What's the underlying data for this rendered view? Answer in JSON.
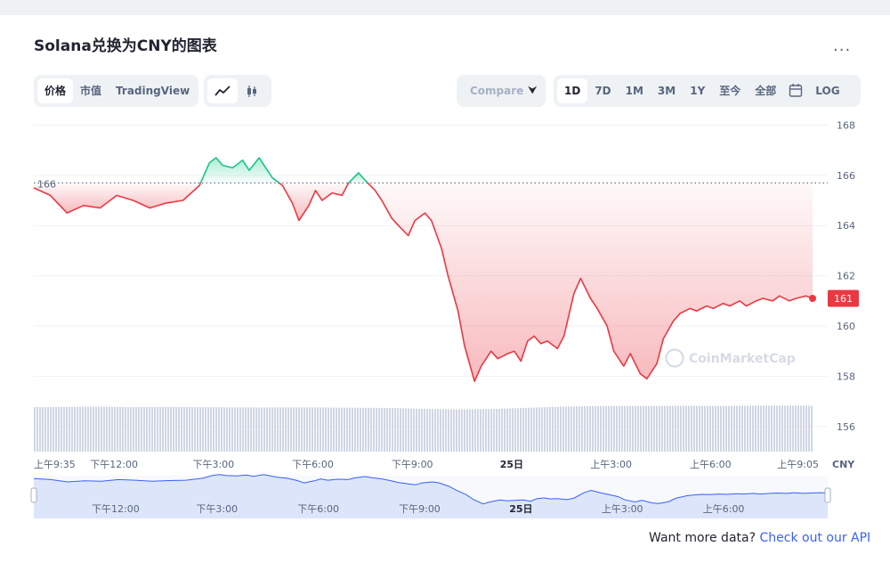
{
  "title": "Solana兑换为CNY的图表",
  "more_label": "...",
  "tabs": [
    {
      "label": "价格",
      "active": true
    },
    {
      "label": "市值",
      "active": false
    },
    {
      "label": "TradingView",
      "active": false
    }
  ],
  "chart_type_icons": [
    {
      "icon": "line-chart-icon",
      "active": true
    },
    {
      "icon": "candlestick-icon",
      "active": false
    }
  ],
  "compare": {
    "label": "Compare with"
  },
  "ranges": [
    {
      "label": "1D",
      "active": true
    },
    {
      "label": "7D",
      "active": false
    },
    {
      "label": "1M",
      "active": false
    },
    {
      "label": "3M",
      "active": false
    },
    {
      "label": "1Y",
      "active": false
    },
    {
      "label": "至今",
      "active": false
    },
    {
      "label": "全部",
      "active": false
    }
  ],
  "calendar_icon": "calendar-icon",
  "log_label": "LOG",
  "api_text": "Want more data?",
  "api_link": "Check out our API",
  "watermark": "CoinMarketCap",
  "colors": {
    "up": "#16c784",
    "down": "#ea3943",
    "volume": "#cfd6e4",
    "nav_line": "#3861fb",
    "nav_fill": "#dde5fb"
  },
  "chart_data": {
    "type": "line",
    "currency": "CNY",
    "reference_value": 165.7,
    "reference_label": "166",
    "current_value": 161.1,
    "current_label": "161",
    "ylim": [
      155,
      168.3
    ],
    "y_ticks": [
      156,
      158,
      160,
      162,
      164,
      166,
      168
    ],
    "x_tick_labels": [
      {
        "label": "上午9:35",
        "t": 0,
        "bold": false
      },
      {
        "label": "下午12:00",
        "t": 2.42,
        "bold": false
      },
      {
        "label": "下午3:00",
        "t": 5.42,
        "bold": false
      },
      {
        "label": "下午6:00",
        "t": 8.42,
        "bold": false
      },
      {
        "label": "下午9:00",
        "t": 11.42,
        "bold": false
      },
      {
        "label": "25日",
        "t": 14.42,
        "bold": true
      },
      {
        "label": "上午3:00",
        "t": 17.42,
        "bold": false
      },
      {
        "label": "上午6:00",
        "t": 20.42,
        "bold": false
      },
      {
        "label": "上午9:05",
        "t": 23.5,
        "bold": false
      }
    ],
    "nav_tick_labels": [
      {
        "label": "下午12:00",
        "t": 2.42,
        "bold": false
      },
      {
        "label": "下午3:00",
        "t": 5.42,
        "bold": false
      },
      {
        "label": "下午6:00",
        "t": 8.42,
        "bold": false
      },
      {
        "label": "下午9:00",
        "t": 11.42,
        "bold": false
      },
      {
        "label": "25日",
        "t": 14.42,
        "bold": true
      },
      {
        "label": "上午3:00",
        "t": 17.42,
        "bold": false
      },
      {
        "label": "上午6:00",
        "t": 20.42,
        "bold": false
      }
    ],
    "x": [
      0,
      0.5,
      1.0,
      1.5,
      2.0,
      2.5,
      3.0,
      3.5,
      4.0,
      4.5,
      5.0,
      5.3,
      5.5,
      5.7,
      6.0,
      6.3,
      6.5,
      6.8,
      7.0,
      7.2,
      7.5,
      7.8,
      8.0,
      8.3,
      8.5,
      8.7,
      9.0,
      9.3,
      9.5,
      9.8,
      10.0,
      10.3,
      10.5,
      10.8,
      11.0,
      11.3,
      11.5,
      11.8,
      12.0,
      12.3,
      12.5,
      12.8,
      13.0,
      13.3,
      13.5,
      13.8,
      14.0,
      14.3,
      14.5,
      14.7,
      14.9,
      15.1,
      15.3,
      15.5,
      15.8,
      16.0,
      16.3,
      16.5,
      16.8,
      17.0,
      17.3,
      17.5,
      17.8,
      18.0,
      18.3,
      18.5,
      18.8,
      19.0,
      19.3,
      19.5,
      19.8,
      20.0,
      20.3,
      20.5,
      20.8,
      21.0,
      21.3,
      21.5,
      21.8,
      22.0,
      22.3,
      22.5,
      22.8,
      23.0,
      23.3,
      23.5
    ],
    "y": [
      165.5,
      165.2,
      164.5,
      164.8,
      164.7,
      165.2,
      165.0,
      164.7,
      164.9,
      165.0,
      165.6,
      166.5,
      166.7,
      166.4,
      166.3,
      166.6,
      166.2,
      166.7,
      166.3,
      165.9,
      165.6,
      164.9,
      164.2,
      164.8,
      165.4,
      165.0,
      165.3,
      165.2,
      165.7,
      166.1,
      165.8,
      165.4,
      165.0,
      164.3,
      164.0,
      163.6,
      164.2,
      164.5,
      164.2,
      163.1,
      162.0,
      160.6,
      159.2,
      157.8,
      158.4,
      159.0,
      158.7,
      158.9,
      159.0,
      158.6,
      159.4,
      159.6,
      159.3,
      159.4,
      159.1,
      159.6,
      161.3,
      161.9,
      161.1,
      160.7,
      160.0,
      159.0,
      158.4,
      158.9,
      158.1,
      157.9,
      158.5,
      159.5,
      160.2,
      160.5,
      160.7,
      160.6,
      160.8,
      160.7,
      160.9,
      160.8,
      161.0,
      160.8,
      161.0,
      161.1,
      161.0,
      161.2,
      161.0,
      161.1,
      161.2,
      161.1
    ],
    "volume_profile": [
      4,
      4.1,
      4.2,
      4.0,
      4.1,
      4.0,
      3.9,
      3.8,
      3.9,
      3.8,
      3.7,
      3.6,
      3.2,
      3.0,
      3.1,
      3.6,
      4.1,
      4.4,
      4.5,
      4.5,
      4.6,
      4.5,
      4.6,
      4.7,
      4.6
    ]
  }
}
